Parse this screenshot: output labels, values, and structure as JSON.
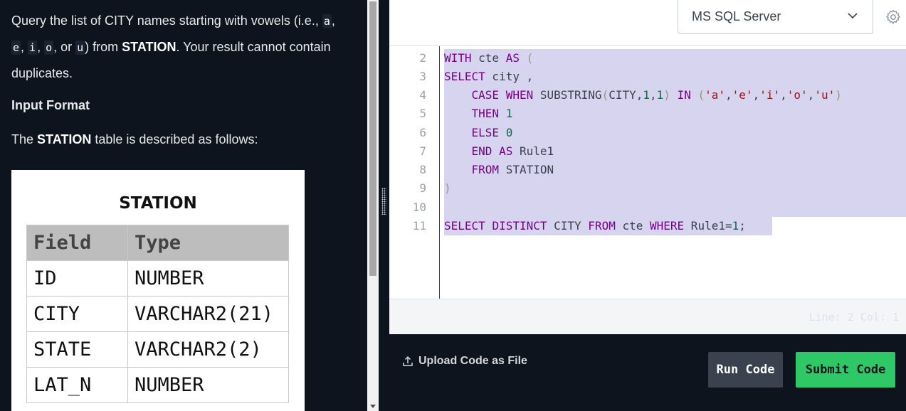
{
  "problem": {
    "text_1": "Query the list of CITY names starting with vowels (i.e., ",
    "code_a": "a",
    "sep_1": ",",
    "code_e": "e",
    "sep_2": ", ",
    "code_i": "i",
    "sep_3": ", ",
    "code_o": "o",
    "sep_4": ", or ",
    "code_u": "u",
    "text_2": ") from ",
    "table_name": "STATION",
    "text_3": ". Your result cannot contain duplicates.",
    "input_format_heading": "Input Format",
    "intro_before": "The ",
    "intro_table": "STATION",
    "intro_after": " table is described as follows:"
  },
  "station_table": {
    "title": "STATION",
    "headers": [
      "Field",
      "Type"
    ],
    "rows": [
      [
        "ID",
        "NUMBER"
      ],
      [
        "CITY",
        "VARCHAR2(21)"
      ],
      [
        "STATE",
        "VARCHAR2(2)"
      ],
      [
        "LAT_N",
        "NUMBER"
      ]
    ]
  },
  "editor": {
    "language": "MS SQL Server",
    "line_numbers": [
      "2",
      "3",
      "4",
      "5",
      "6",
      "7",
      "8",
      "9",
      "10",
      "11"
    ],
    "cursor_position": "Line: 2 Col: 1"
  },
  "actions": {
    "upload_label": "Upload Code as File",
    "run_label": "Run Code",
    "submit_label": "Submit Code"
  },
  "colors": {
    "background": "#0e141e",
    "selection": "#d7d4f0",
    "submit": "#2ec866",
    "run": "#39424e",
    "keyword": "#770088"
  },
  "icons": [
    "chevron-down-icon",
    "settings-icon",
    "upload-icon"
  ]
}
